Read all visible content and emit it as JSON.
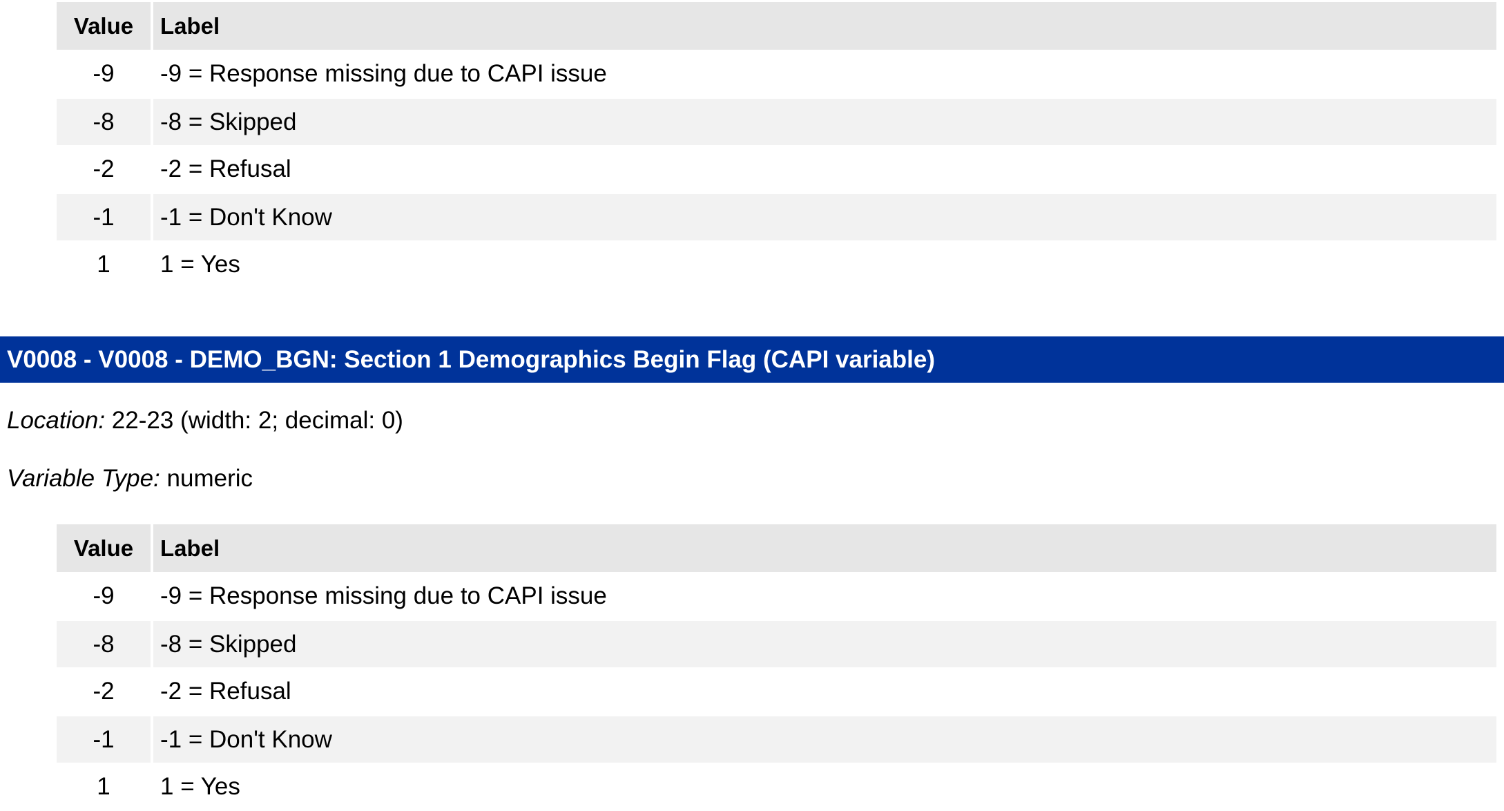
{
  "table_top": {
    "headers": {
      "value": "Value",
      "label": "Label"
    },
    "rows": [
      {
        "value": "-9",
        "label": "-9 = Response missing due to CAPI issue"
      },
      {
        "value": "-8",
        "label": "-8 = Skipped"
      },
      {
        "value": "-2",
        "label": "-2 = Refusal"
      },
      {
        "value": "-1",
        "label": "-1 = Don't Know"
      },
      {
        "value": "1",
        "label": "1 = Yes"
      }
    ]
  },
  "variable": {
    "title": "V0008 - V0008 - DEMO_BGN: Section 1 Demographics Begin Flag (CAPI variable)",
    "location_key": "Location:",
    "location_value": "22-23 (width: 2; decimal: 0)",
    "type_key": "Variable Type:",
    "type_value": "numeric",
    "header_color": "#00339a"
  },
  "table_bottom": {
    "headers": {
      "value": "Value",
      "label": "Label"
    },
    "rows": [
      {
        "value": "-9",
        "label": "-9 = Response missing due to CAPI issue"
      },
      {
        "value": "-8",
        "label": "-8 = Skipped"
      },
      {
        "value": "-2",
        "label": "-2 = Refusal"
      },
      {
        "value": "-1",
        "label": "-1 = Don't Know"
      },
      {
        "value": "1",
        "label": "1 = Yes"
      }
    ]
  }
}
